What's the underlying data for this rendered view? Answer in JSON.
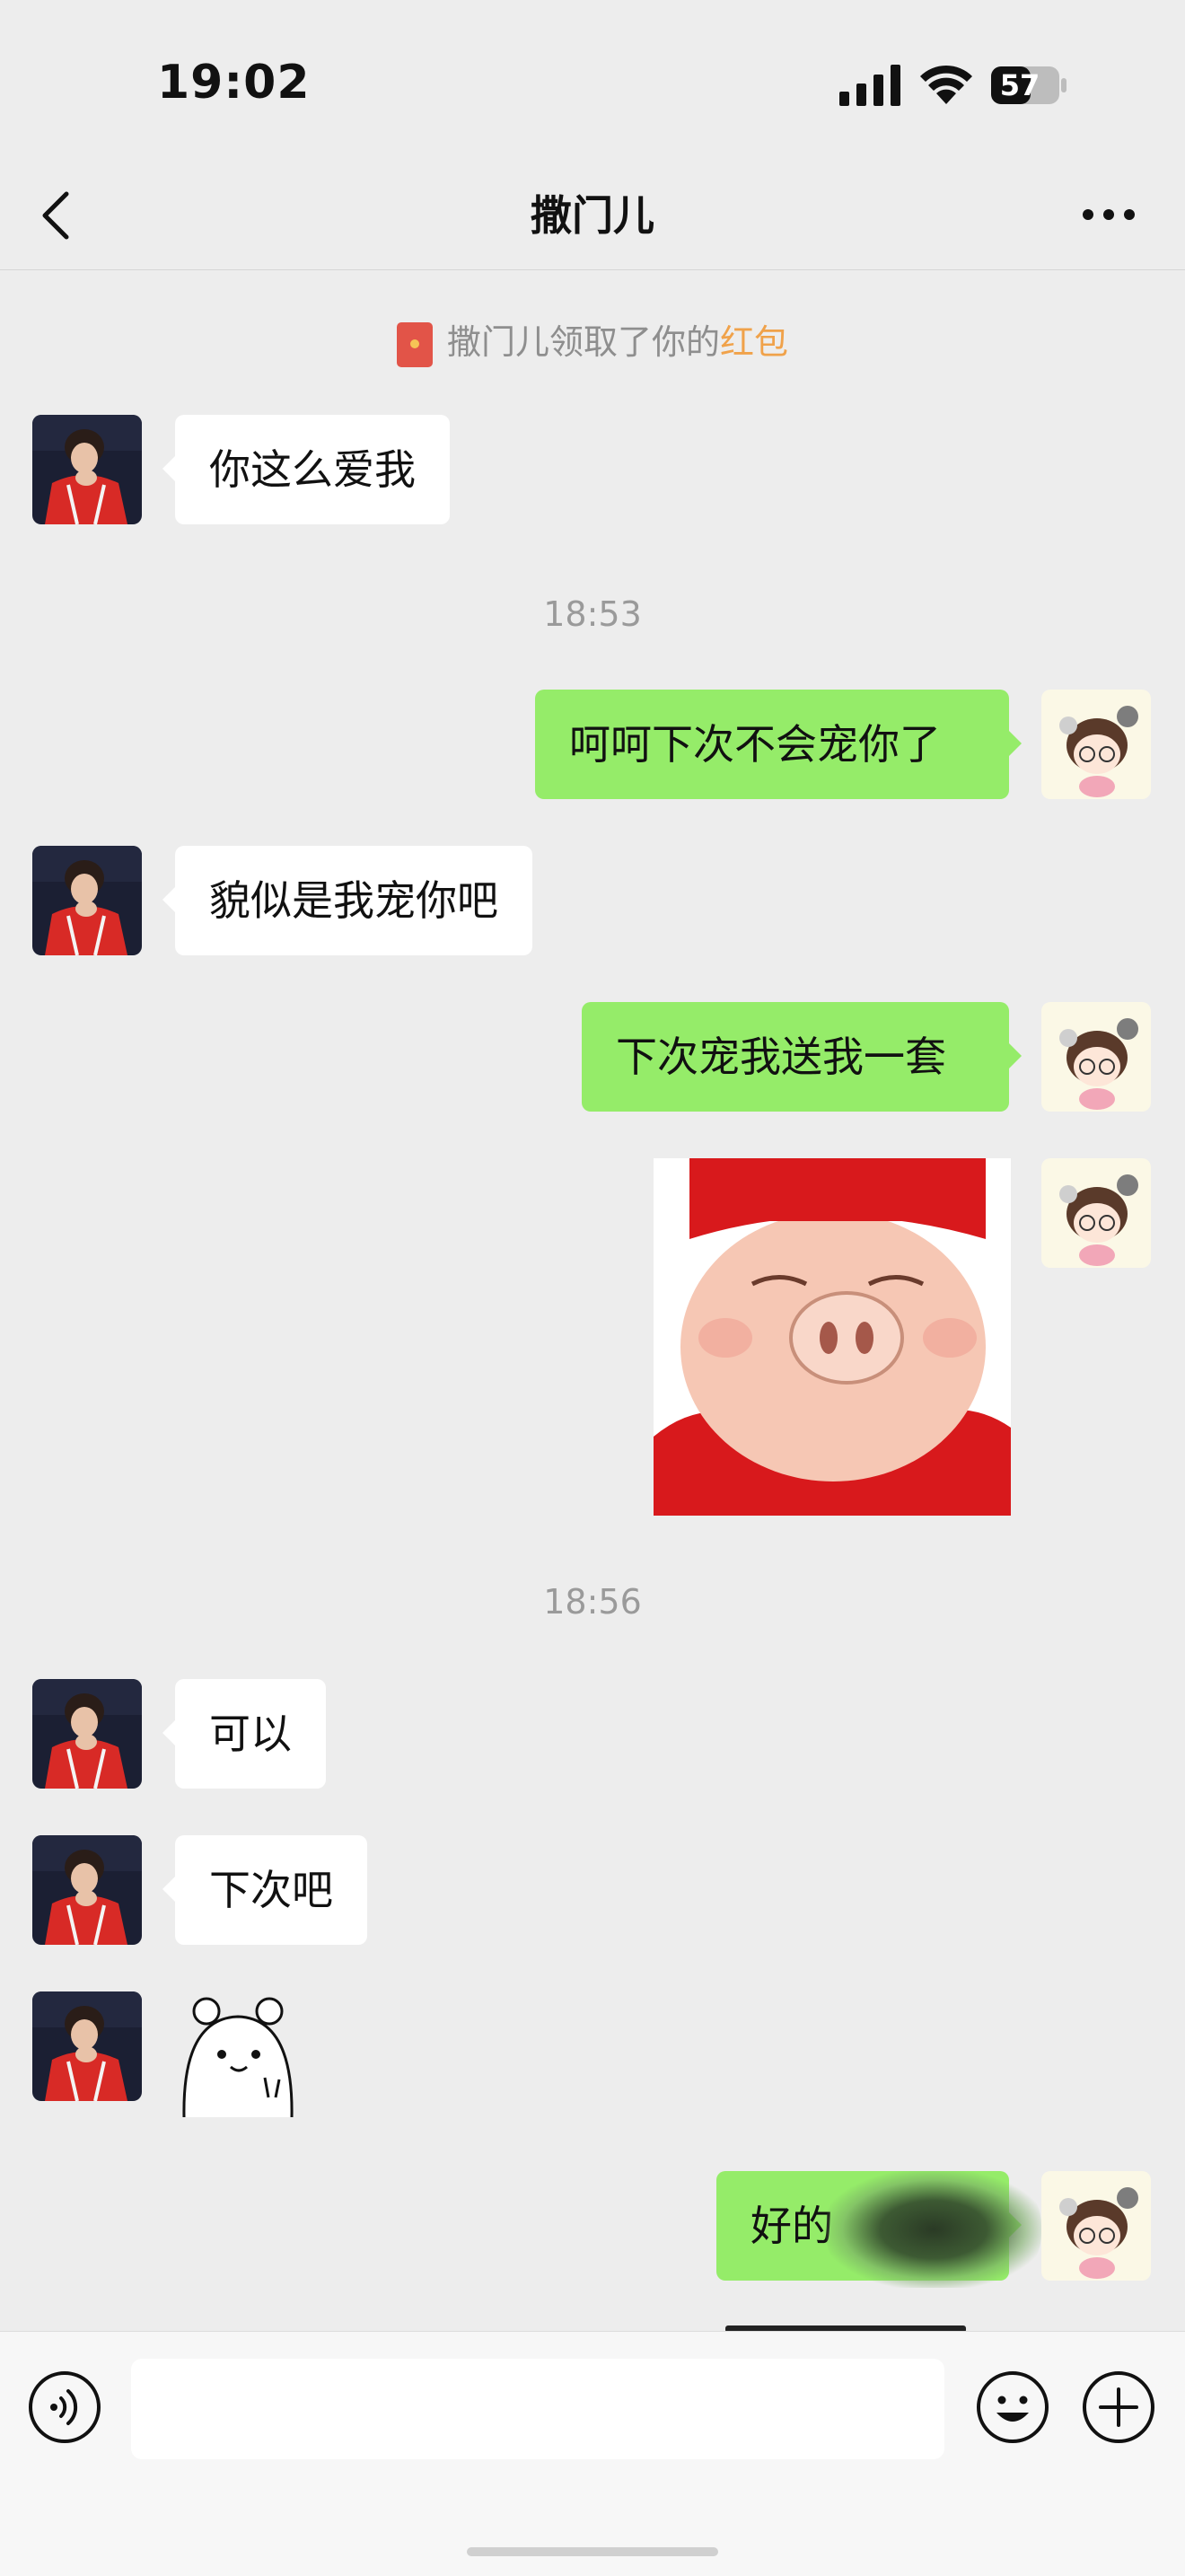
{
  "status_bar": {
    "time": "19:02",
    "battery": "57"
  },
  "nav": {
    "title": "撒门儿"
  },
  "system": {
    "notice_prefix": "撒门儿领取了你的",
    "notice_link": "红包"
  },
  "timestamps": [
    "18:53",
    "18:56"
  ],
  "messages": [
    {
      "side": "left",
      "text": "你这么爱我"
    },
    {
      "side": "right",
      "text": "呵呵下次不会宠你了"
    },
    {
      "side": "left",
      "text": "貌似是我宠你吧"
    },
    {
      "side": "right",
      "text": "下次宠我送我一套"
    },
    {
      "side": "right",
      "sticker": "pig-sticker"
    },
    {
      "side": "left",
      "text": "可以"
    },
    {
      "side": "left",
      "text": "下次吧"
    },
    {
      "side": "left",
      "sticker": "bear-sticker"
    },
    {
      "side": "right",
      "text": "好的"
    }
  ],
  "input": {
    "placeholder": ""
  },
  "colors": {
    "bubble_self": "#95ec69",
    "bubble_other": "#ffffff",
    "background": "#ededed",
    "red_packet_link": "#f0a24a"
  }
}
